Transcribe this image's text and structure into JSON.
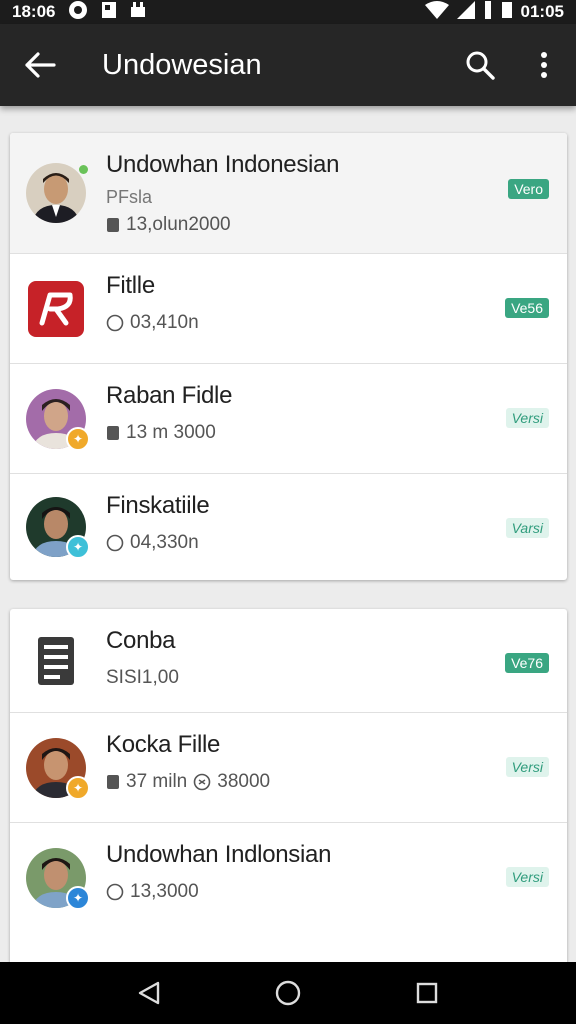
{
  "status_bar": {
    "time_left": "18:06",
    "time_right": "01:05"
  },
  "app_bar": {
    "title": "Undowesian"
  },
  "card1": [
    {
      "name": "Undowhan Indonesian",
      "sub": "PFsla",
      "meta": "13,olun2000",
      "badge": "Vero",
      "badge_style": "filled"
    },
    {
      "name": "Fitlle",
      "sub": "",
      "meta": "03,410n",
      "badge": "Ve56",
      "badge_style": "filled"
    },
    {
      "name": "Raban Fidle",
      "sub": "",
      "meta": "13 m 3000",
      "badge": "Versi",
      "badge_style": "outline"
    },
    {
      "name": "Finskatiile",
      "sub": "",
      "meta": "04,330n",
      "badge": "Varsi",
      "badge_style": "outline"
    }
  ],
  "card2": [
    {
      "name": "Conba",
      "sub": "",
      "meta": "SISI1,00",
      "badge": "Ve76",
      "badge_style": "filled"
    },
    {
      "name": "Kocka Fille",
      "sub": "",
      "meta": "37 miln",
      "meta2": "38000",
      "badge": "Versi",
      "badge_style": "outline"
    },
    {
      "name": "Undowhan Indlonsian",
      "sub": "",
      "meta": "13,3000",
      "badge": "Versi",
      "badge_style": "outline"
    }
  ],
  "colors": {
    "accent": "#3aa682",
    "appbar": "#262626",
    "statusbar": "#1c1c1c"
  },
  "icons": [
    "back-arrow-icon",
    "search-icon",
    "more-vert-icon",
    "back-nav-icon",
    "home-nav-icon",
    "recents-nav-icon"
  ]
}
